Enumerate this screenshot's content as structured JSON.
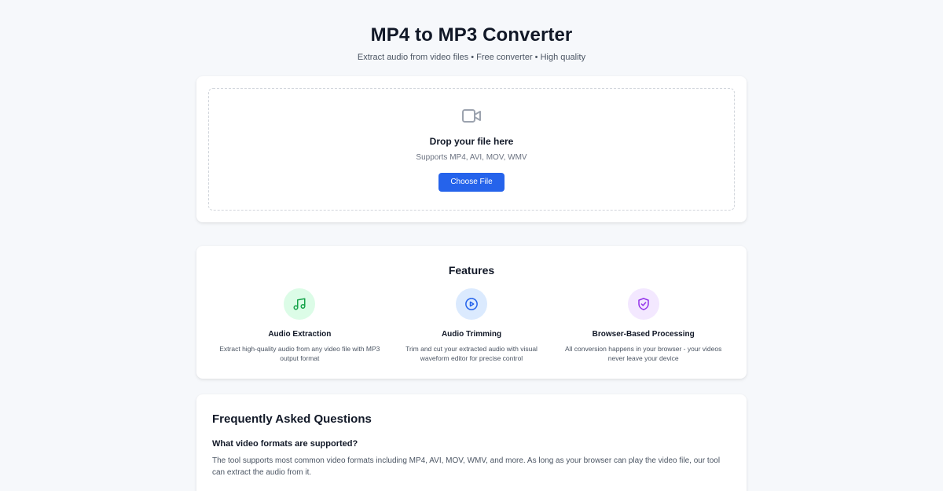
{
  "header": {
    "title": "MP4 to MP3 Converter",
    "subtitle": "Extract audio from video files • Free converter • High quality"
  },
  "upload": {
    "icon": "video-camera-icon",
    "title": "Drop your file here",
    "supported": "Supports MP4, AVI, MOV, WMV",
    "button_label": "Choose File",
    "button_color": "#2563eb"
  },
  "features": {
    "title": "Features",
    "items": [
      {
        "icon": "music-note-icon",
        "icon_bg": "#dcfce7",
        "icon_color": "#16a34a",
        "name": "Audio Extraction",
        "desc": "Extract high-quality audio from any video file with MP3 output format"
      },
      {
        "icon": "play-circle-icon",
        "icon_bg": "#dbeafe",
        "icon_color": "#2563eb",
        "name": "Audio Trimming",
        "desc": "Trim and cut your extracted audio with visual waveform editor for precise control"
      },
      {
        "icon": "shield-check-icon",
        "icon_bg": "#f3e8ff",
        "icon_color": "#9333ea",
        "name": "Browser-Based Processing",
        "desc": "All conversion happens in your browser - your videos never leave your device"
      }
    ]
  },
  "faq": {
    "title": "Frequently Asked Questions",
    "items": [
      {
        "question": "What video formats are supported?",
        "answer": "The tool supports most common video formats including MP4, AVI, MOV, WMV, and more. As long as your browser can play the video file, our tool can extract the audio from it."
      }
    ]
  }
}
